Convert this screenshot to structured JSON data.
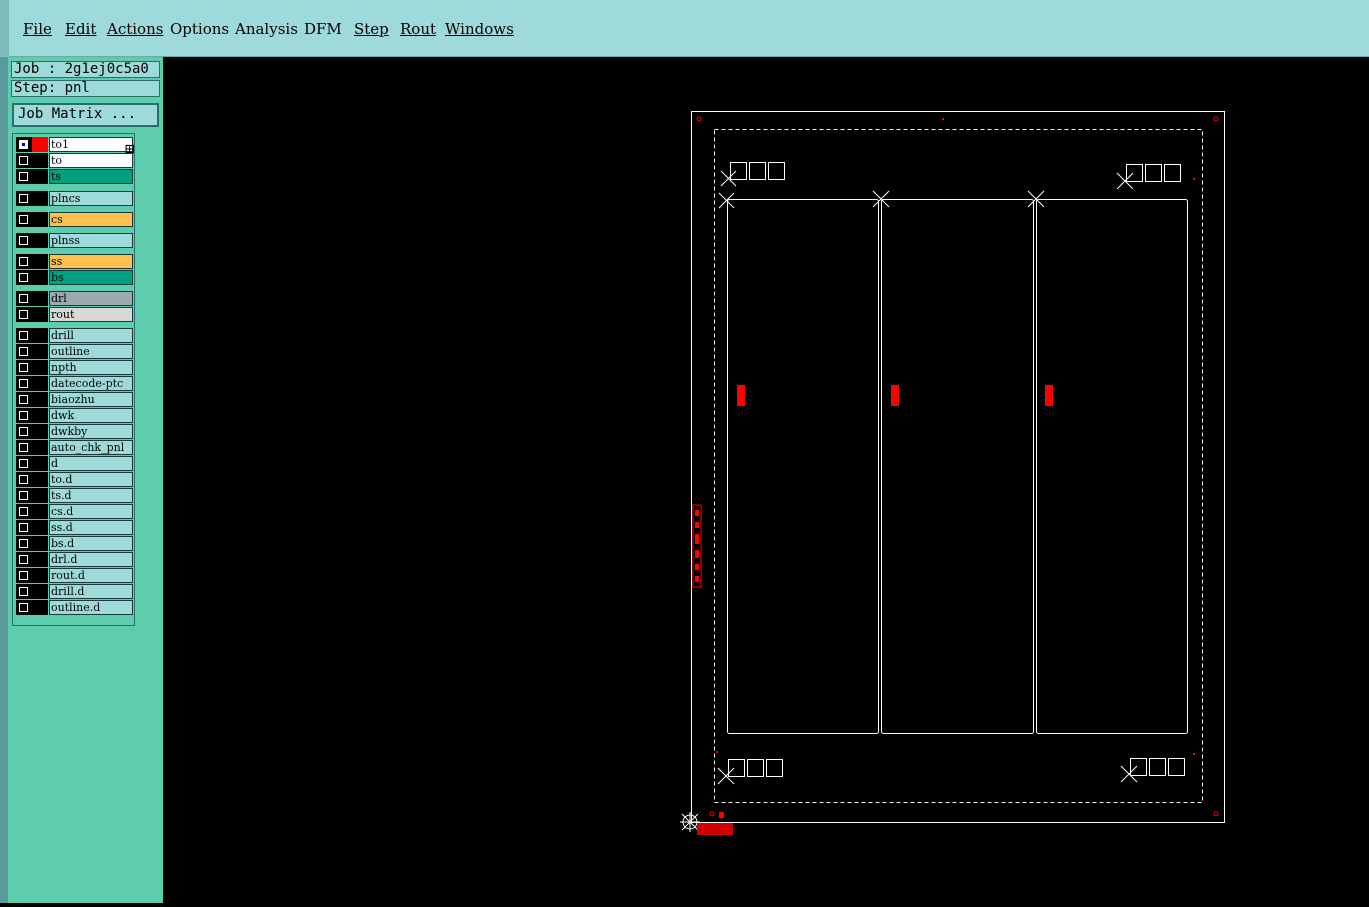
{
  "menu": [
    "File",
    "Edit",
    "Actions",
    "Options",
    "Analysis",
    "DFM",
    "Step",
    "Rout",
    "Windows"
  ],
  "job_label": "Job : 2g1ej0c5a0",
  "step_label": "Step: pnl",
  "job_matrix_button": "Job Matrix ...",
  "layers": [
    {
      "name": "to1",
      "color": "#ffffff",
      "swatch": "#ff0000",
      "checked": true,
      "mark": "⊞"
    },
    {
      "name": "to",
      "color": "#ffffff"
    },
    {
      "name": "ts",
      "color": "#00a080"
    },
    {
      "name": "plncs",
      "color": "#9fdada"
    },
    {
      "name": "cs",
      "color": "#ffc050"
    },
    {
      "name": "plnss",
      "color": "#9fdada"
    },
    {
      "name": "ss",
      "color": "#ffc050"
    },
    {
      "name": "bs",
      "color": "#00a080"
    },
    {
      "name": "drl",
      "color": "#9aaab0"
    },
    {
      "name": "rout",
      "color": "#d8d8d8"
    },
    {
      "name": "drill",
      "color": "#9fdada"
    },
    {
      "name": "outline",
      "color": "#9fdada"
    },
    {
      "name": "npth",
      "color": "#9fdada"
    },
    {
      "name": "datecode-ptc",
      "color": "#9fdada"
    },
    {
      "name": "biaozhu",
      "color": "#9fdada"
    },
    {
      "name": "dwk",
      "color": "#9fdada"
    },
    {
      "name": "dwkby",
      "color": "#9fdada"
    },
    {
      "name": "auto_chk_pnl",
      "color": "#9fdada"
    },
    {
      "name": "d",
      "color": "#9fdada"
    },
    {
      "name": "to.d",
      "color": "#9fdada"
    },
    {
      "name": "ts.d",
      "color": "#9fdada"
    },
    {
      "name": "cs.d",
      "color": "#9fdada"
    },
    {
      "name": "ss.d",
      "color": "#9fdada"
    },
    {
      "name": "bs.d",
      "color": "#9fdada"
    },
    {
      "name": "drl.d",
      "color": "#9fdada"
    },
    {
      "name": "rout.d",
      "color": "#9fdada"
    },
    {
      "name": "drill.d",
      "color": "#9fdada"
    },
    {
      "name": "outline.d",
      "color": "#9fdada"
    }
  ],
  "colors": {
    "menubar": "#9fdada",
    "sidebar": "#5ecdae",
    "canvas": "#000000",
    "drawing_line": "#ffffff",
    "feature_red": "#ff0000"
  }
}
